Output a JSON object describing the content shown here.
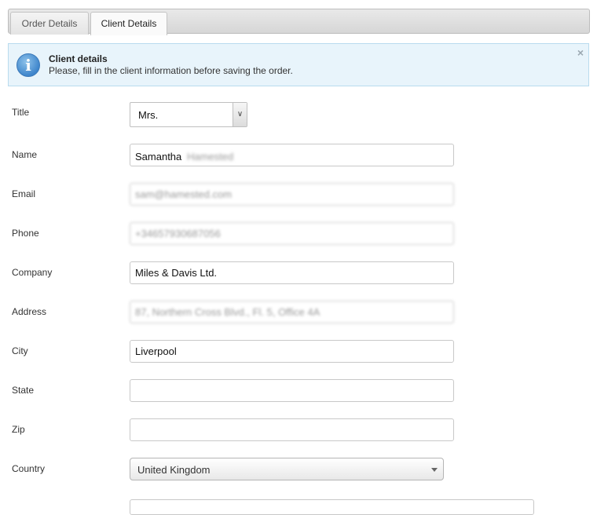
{
  "tabs": [
    {
      "label": "Order Details",
      "active": false
    },
    {
      "label": "Client Details",
      "active": true
    }
  ],
  "info_box": {
    "icon": "info-icon",
    "icon_glyph": "i",
    "title": "Client details",
    "text": "Please, fill in the client information before saving the order.",
    "close_glyph": "×"
  },
  "form": {
    "title": {
      "label": "Title",
      "value": "Mrs."
    },
    "name": {
      "label": "Name",
      "first": "Samantha",
      "last": "Hamested"
    },
    "email": {
      "label": "Email",
      "value": "sam@hamested.com"
    },
    "phone": {
      "label": "Phone",
      "value": "+34657930687056"
    },
    "company": {
      "label": "Company",
      "value": "Miles & Davis Ltd."
    },
    "address": {
      "label": "Address",
      "value": "87, Northern Cross Blvd., Fl. 5, Office 4A"
    },
    "city": {
      "label": "City",
      "value": "Liverpool"
    },
    "state": {
      "label": "State",
      "value": ""
    },
    "zip": {
      "label": "Zip",
      "value": ""
    },
    "country": {
      "label": "Country",
      "value": "United Kingdom"
    }
  },
  "colors": {
    "info_background": "#e8f4fb",
    "info_border": "#b9dbee",
    "info_icon": "#3f86cc"
  }
}
